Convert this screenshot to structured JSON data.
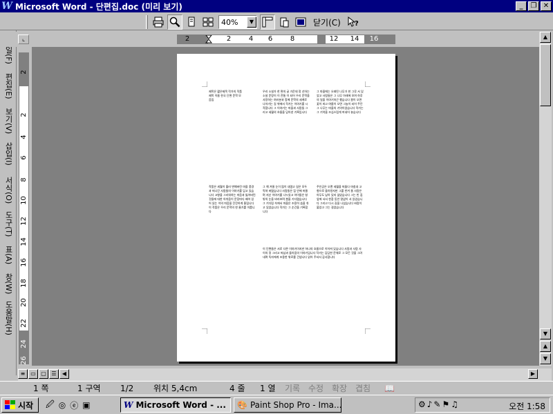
{
  "window": {
    "title": "Microsoft Word - 단편집.doc (미리 보기)",
    "logo": "W",
    "buttons": [
      "_",
      "❐",
      "✕"
    ]
  },
  "toolbar": {
    "zoom_value": "40%",
    "close_label": "닫기(C)",
    "buttons": [
      "print-icon",
      "magnifier-icon",
      "one-page-icon",
      "multiple-pages-icon",
      "view-ruler-icon",
      "shrink-to-fit-icon",
      "full-screen-icon",
      "context-help-icon"
    ]
  },
  "hruler": {
    "labels": [
      "2",
      "2",
      "4",
      "6",
      "8",
      "12",
      "14",
      "16"
    ]
  },
  "vruler": {
    "labels": [
      "2",
      "2",
      "4",
      "6",
      "8",
      "10",
      "12",
      "14",
      "16",
      "18",
      "20",
      "22",
      "24",
      "26"
    ]
  },
  "sidebar_menu": [
    "파일(F)",
    "편집(E)",
    "보기(V)",
    "삽입(I)",
    "서식(O)",
    "도구(T)",
    "표(A)",
    "창(W)",
    "도움말(H)"
  ],
  "page": {
    "text_blocks": [
      "제목은 짧은제목 작가의 작품 제목 이름 한국 단편 문학 모음집",
      "우리 소설가 한 편의 글 가운데 정 선하는 소설 문장이 이 전통 이 되어 우리 문학을 사랑하는 여러분과 함께 문학의 세계로 나아가는 길 위에서 작가는 이야기를 시작합니다 그 이야기는 마을과 사람들 그리고 세월의 흐름을 담아낸 기록입니다",
      "그 마을에는 오래된 나무가 한 그루 서 있었고 사람들은 그 나무 아래에 모여 하루의 일을 이야기하곤 했습니다 봄이 오면 꽃이 피고 여름이 오면 그늘이 되어 주던 그 나무는 마을의 기억이었습니다 작가는 그 기억을 조심스럽게 꺼내어 놓습니다",
      "작품은 세월이 흘러 변해버린 마을 풍경과 떠나간 사람들의 이야기를 담고 있습니다 고향을 그리워하는 마음과 잃어버린 것들에 대한 아쉬움이 문장마다 배어 있어 읽는 이의 마음을 잔잔하게 울립니다 이 작품은 우리 문학의 한 줄기를 이룹니다",
      "그 해 겨울 눈이 많이 내렸고 길은 모두 막혀 버렸습니다 사람들은 집 안에 머물며 지난 이야기를 나누었고 아이들은 창밖의 눈을 바라보며 봄을 기다렸습니다 그 기다림 속에서 마을은 조용히 숨을 쉬고 있었습니다 작가는 그 순간을 기록합니다",
      "주인공은 오랜 세월을 떠돌다 마침내 고향으로 돌아왔지만 그를 반겨 줄 사람은 아무도 남아 있지 않았습니다 그는 빈 집 앞에 서서 한참 동안 말없이 서 있었습니다 그리고 다시 길을 나섰습니다 바람이 불었고 그는 걸었습니다",
      "이 단편들은 서로 다른 이야기이지만 하나의 흐름으로 이어져 있습니다 사람과 사람 사이의 정 그리고 떠남과 돌아옴의 이야기입니다 작가는 담담한 문체로 그 모든 것을 그려 내며 독자에게 조용한 위로를 건넵니다 읽어 주셔서 감사합니다"
    ]
  },
  "status": {
    "page": "1 쪽",
    "section": "1 구역",
    "page_of": "1/2",
    "position": "위치 5,4cm",
    "line": "4 줄",
    "column": "1 열",
    "rec": "기록",
    "trk": "수정",
    "ext": "확장",
    "ovr": "겹침"
  },
  "taskbar": {
    "start_label": "시작",
    "tasks": [
      "Microsoft Word - ...",
      "Paint Shop Pro - Ima..."
    ],
    "clock": "오전 1:58"
  }
}
